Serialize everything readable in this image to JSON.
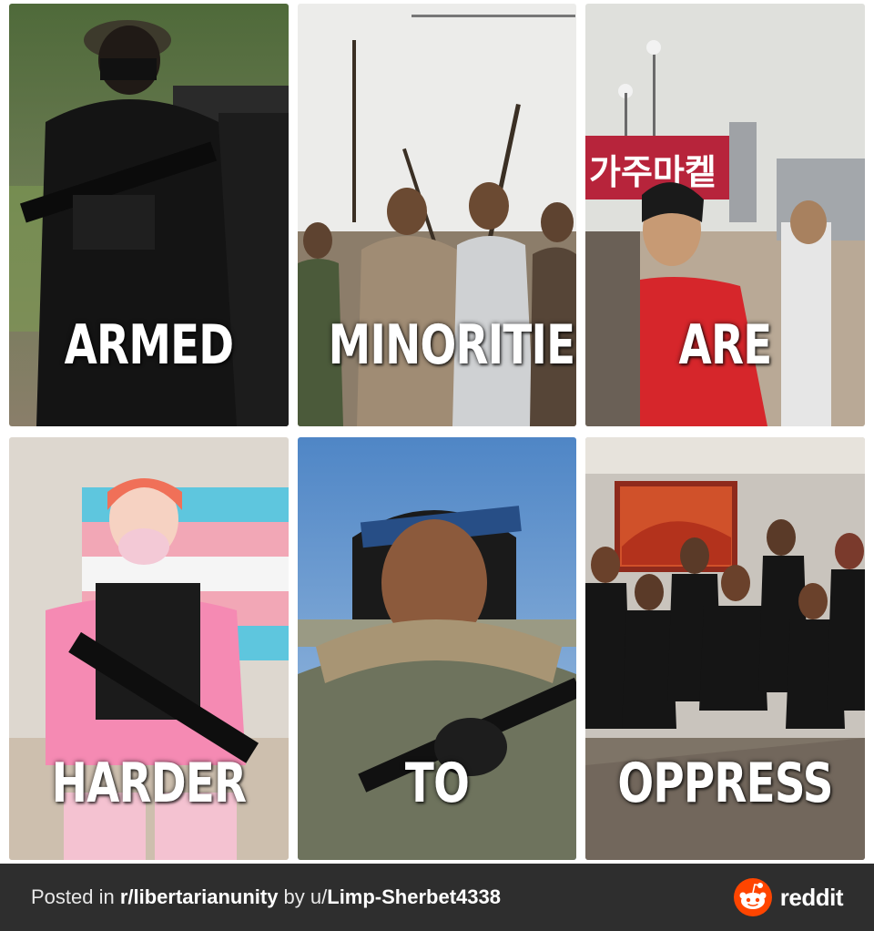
{
  "panels": [
    {
      "caption": "ARMED"
    },
    {
      "caption": "MINORITIES"
    },
    {
      "caption": "ARE",
      "sign_text": "가주마켙"
    },
    {
      "caption": "HARDER"
    },
    {
      "caption": "TO"
    },
    {
      "caption": "OPPRESS"
    }
  ],
  "footer": {
    "prefix": "Posted in ",
    "subreddit": "r/libertarianunity",
    "middle": " by u/",
    "username": "Limp-Sherbet4338",
    "brand": "reddit",
    "brand_icon": "reddit-snoo-icon",
    "brand_color": "#ff4500",
    "background": "#2e2e2e"
  }
}
